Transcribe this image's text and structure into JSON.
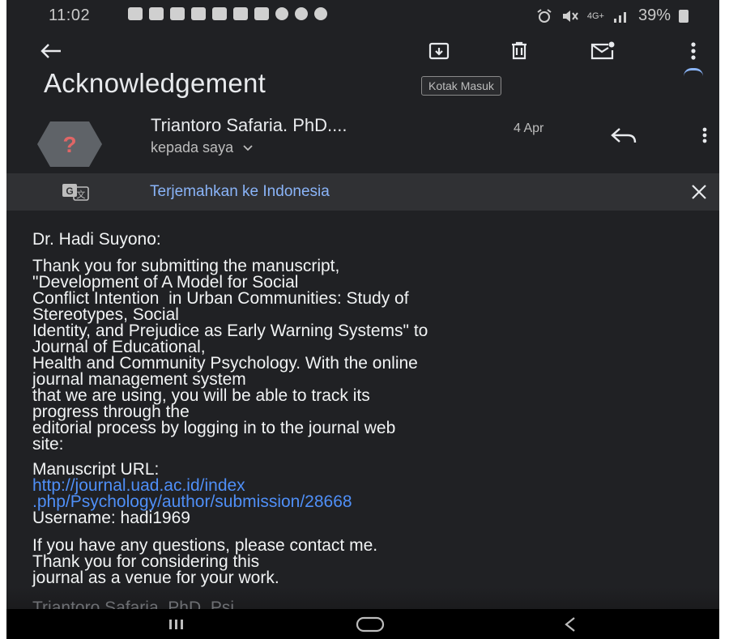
{
  "status_bar": {
    "time": "11:02",
    "network": "4G+",
    "battery": "39%"
  },
  "email": {
    "subject": "Acknowledgement",
    "label": "Kotak Masuk",
    "sender": "Triantoro Safaria. PhD....",
    "date": "4 Apr",
    "recipient": "kepada saya"
  },
  "translate": {
    "text": "Terjemahkan ke Indonesia"
  },
  "body": {
    "greeting": "Dr. Hadi Suyono:",
    "paragraph1_lines": [
      "Thank you for submitting the manuscript,",
      "\"Development of A Model for Social",
      "Conflict Intention  in Urban Communities: Study of",
      "Stereotypes, Social",
      "Identity, and Prejudice as Early Warning Systems\" to",
      "Journal of Educational,",
      "Health and Community Psychology. With the online",
      "journal management system",
      "that we are using, you will be able to track its",
      "progress through the",
      "editorial process by logging in to the journal web",
      "site:"
    ],
    "manuscript_url_label": "Manuscript URL:",
    "url_line1": "http://journal.uad.ac.id/index",
    "url_line2": ".php/Psychology/author/submission/28668",
    "username": "Username: hadi1969",
    "closing_lines": [
      "If you have any questions, please contact me.",
      "Thank you for considering this",
      "journal as a venue for your work."
    ],
    "signature_partial": "Triantoro Safaria. PhD. Psi"
  },
  "icons": {
    "back": "arrow-left-icon",
    "archive": "archive-icon",
    "delete": "trash-icon",
    "mark_unread": "mail-unread-icon",
    "more": "more-vert-icon",
    "reply": "reply-icon",
    "translate": "translate-icon",
    "close": "close-icon"
  },
  "colors": {
    "background": "#202124",
    "link": "#4f8ff7",
    "translate_link": "#8ab4f8",
    "avatar": "#5f6368",
    "avatar_question": "#e06666"
  }
}
